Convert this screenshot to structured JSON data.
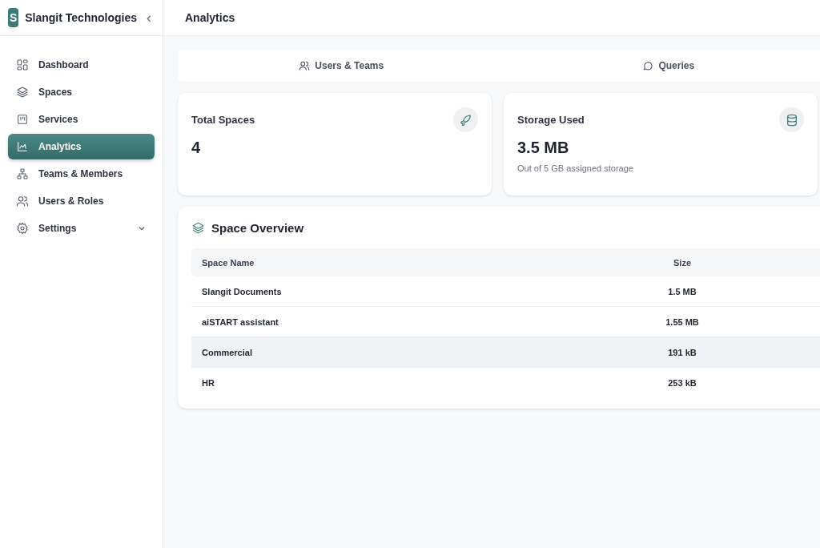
{
  "sidebar": {
    "brand_initial": "S",
    "brand_name": "Slangit Technologies",
    "collapse": "‹",
    "items": [
      {
        "label": "Dashboard",
        "selected": false,
        "kind": "link"
      },
      {
        "label": "Spaces",
        "selected": false,
        "kind": "link"
      },
      {
        "label": "Services",
        "selected": false,
        "kind": "link"
      },
      {
        "label": "Analytics",
        "selected": true,
        "kind": "link"
      },
      {
        "label": "Teams & Members",
        "selected": false,
        "kind": "link"
      },
      {
        "label": "Users & Roles",
        "selected": false,
        "kind": "link"
      },
      {
        "label": "Settings",
        "selected": false,
        "kind": "group"
      }
    ]
  },
  "header": {
    "title": "Analytics"
  },
  "tabs": [
    {
      "label": "Users & Teams"
    },
    {
      "label": "Queries"
    }
  ],
  "stats": [
    {
      "title": "Total Spaces",
      "value": "4"
    },
    {
      "title": "Storage Used",
      "value": "3.5 MB",
      "note": "Out of 5 GB assigned storage"
    }
  ],
  "overview": {
    "title": "Space Overview",
    "columns": [
      "Space Name",
      "Size"
    ],
    "rows": [
      {
        "name": "Slangit Documents",
        "size": "1.5 MB",
        "highlighted": false
      },
      {
        "name": "aiSTART assistant",
        "size": "1.55 MB",
        "highlighted": false
      },
      {
        "name": "Commercial",
        "size": "191 kB",
        "highlighted": true
      },
      {
        "name": "HR",
        "size": "253 kB",
        "highlighted": false
      }
    ]
  }
}
